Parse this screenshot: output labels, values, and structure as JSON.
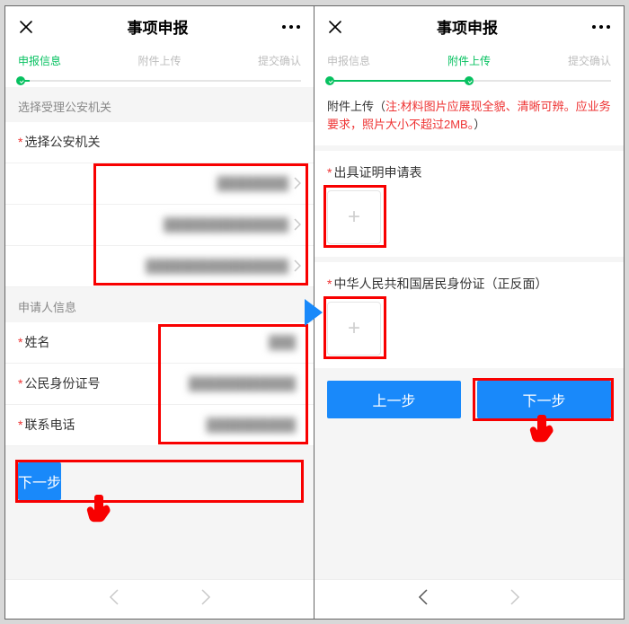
{
  "colors": {
    "accent": "#1989fa",
    "success": "#07c160",
    "danger": "#e33",
    "highlight": "#f80000"
  },
  "header": {
    "title": "事项申报",
    "close_glyph": "×",
    "more_glyph": "···"
  },
  "steps": {
    "labels": [
      "申报信息",
      "附件上传",
      "提交确认"
    ]
  },
  "left": {
    "active_step_index": 0,
    "section1_title": "选择受理公安机关",
    "agency_label": "选择公安机关",
    "agency_rows": [
      "████████",
      "██████████████",
      "████████████████"
    ],
    "section2_title": "申请人信息",
    "fields": [
      {
        "label": "姓名",
        "value": "███"
      },
      {
        "label": "公民身份证号",
        "value": "████████████"
      },
      {
        "label": "联系电话",
        "value": "██████████"
      }
    ],
    "next_label": "下一步"
  },
  "right": {
    "active_step_index": 1,
    "notice_prefix": "附件上传（",
    "notice_warn": "注:材料图片应展现全貌、清晰可辨。应业务要求，照片大小不超过2MB。",
    "notice_suffix": "）",
    "uploads": [
      {
        "label": "出具证明申请表"
      },
      {
        "label": "中华人民共和国居民身份证（正反面）"
      }
    ],
    "prev_label": "上一步",
    "next_label": "下一步"
  },
  "bottom_nav": {
    "back_enabled": false,
    "fwd_enabled": true
  }
}
